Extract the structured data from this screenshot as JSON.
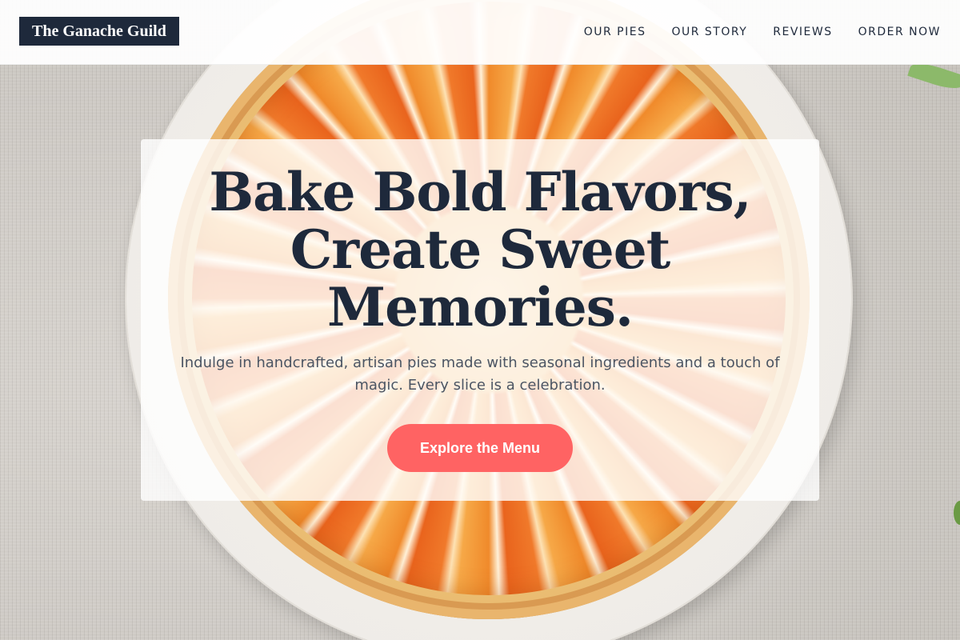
{
  "header": {
    "brand": "The Ganache Guild",
    "nav": [
      {
        "label": "OUR PIES"
      },
      {
        "label": "OUR STORY"
      },
      {
        "label": "REVIEWS"
      },
      {
        "label": "ORDER NOW"
      }
    ]
  },
  "hero": {
    "headline_lines": [
      "Bake Bold Flavors,",
      "Create Sweet",
      "Memories."
    ],
    "subtitle": "Indulge in handcrafted, artisan pies made with seasonal ingredients and a touch of magic. Every slice is a celebration.",
    "cta_label": "Explore the Menu"
  },
  "colors": {
    "brand_dark": "#1e293b",
    "accent": "#ff6363",
    "text_muted": "#4b5563"
  }
}
